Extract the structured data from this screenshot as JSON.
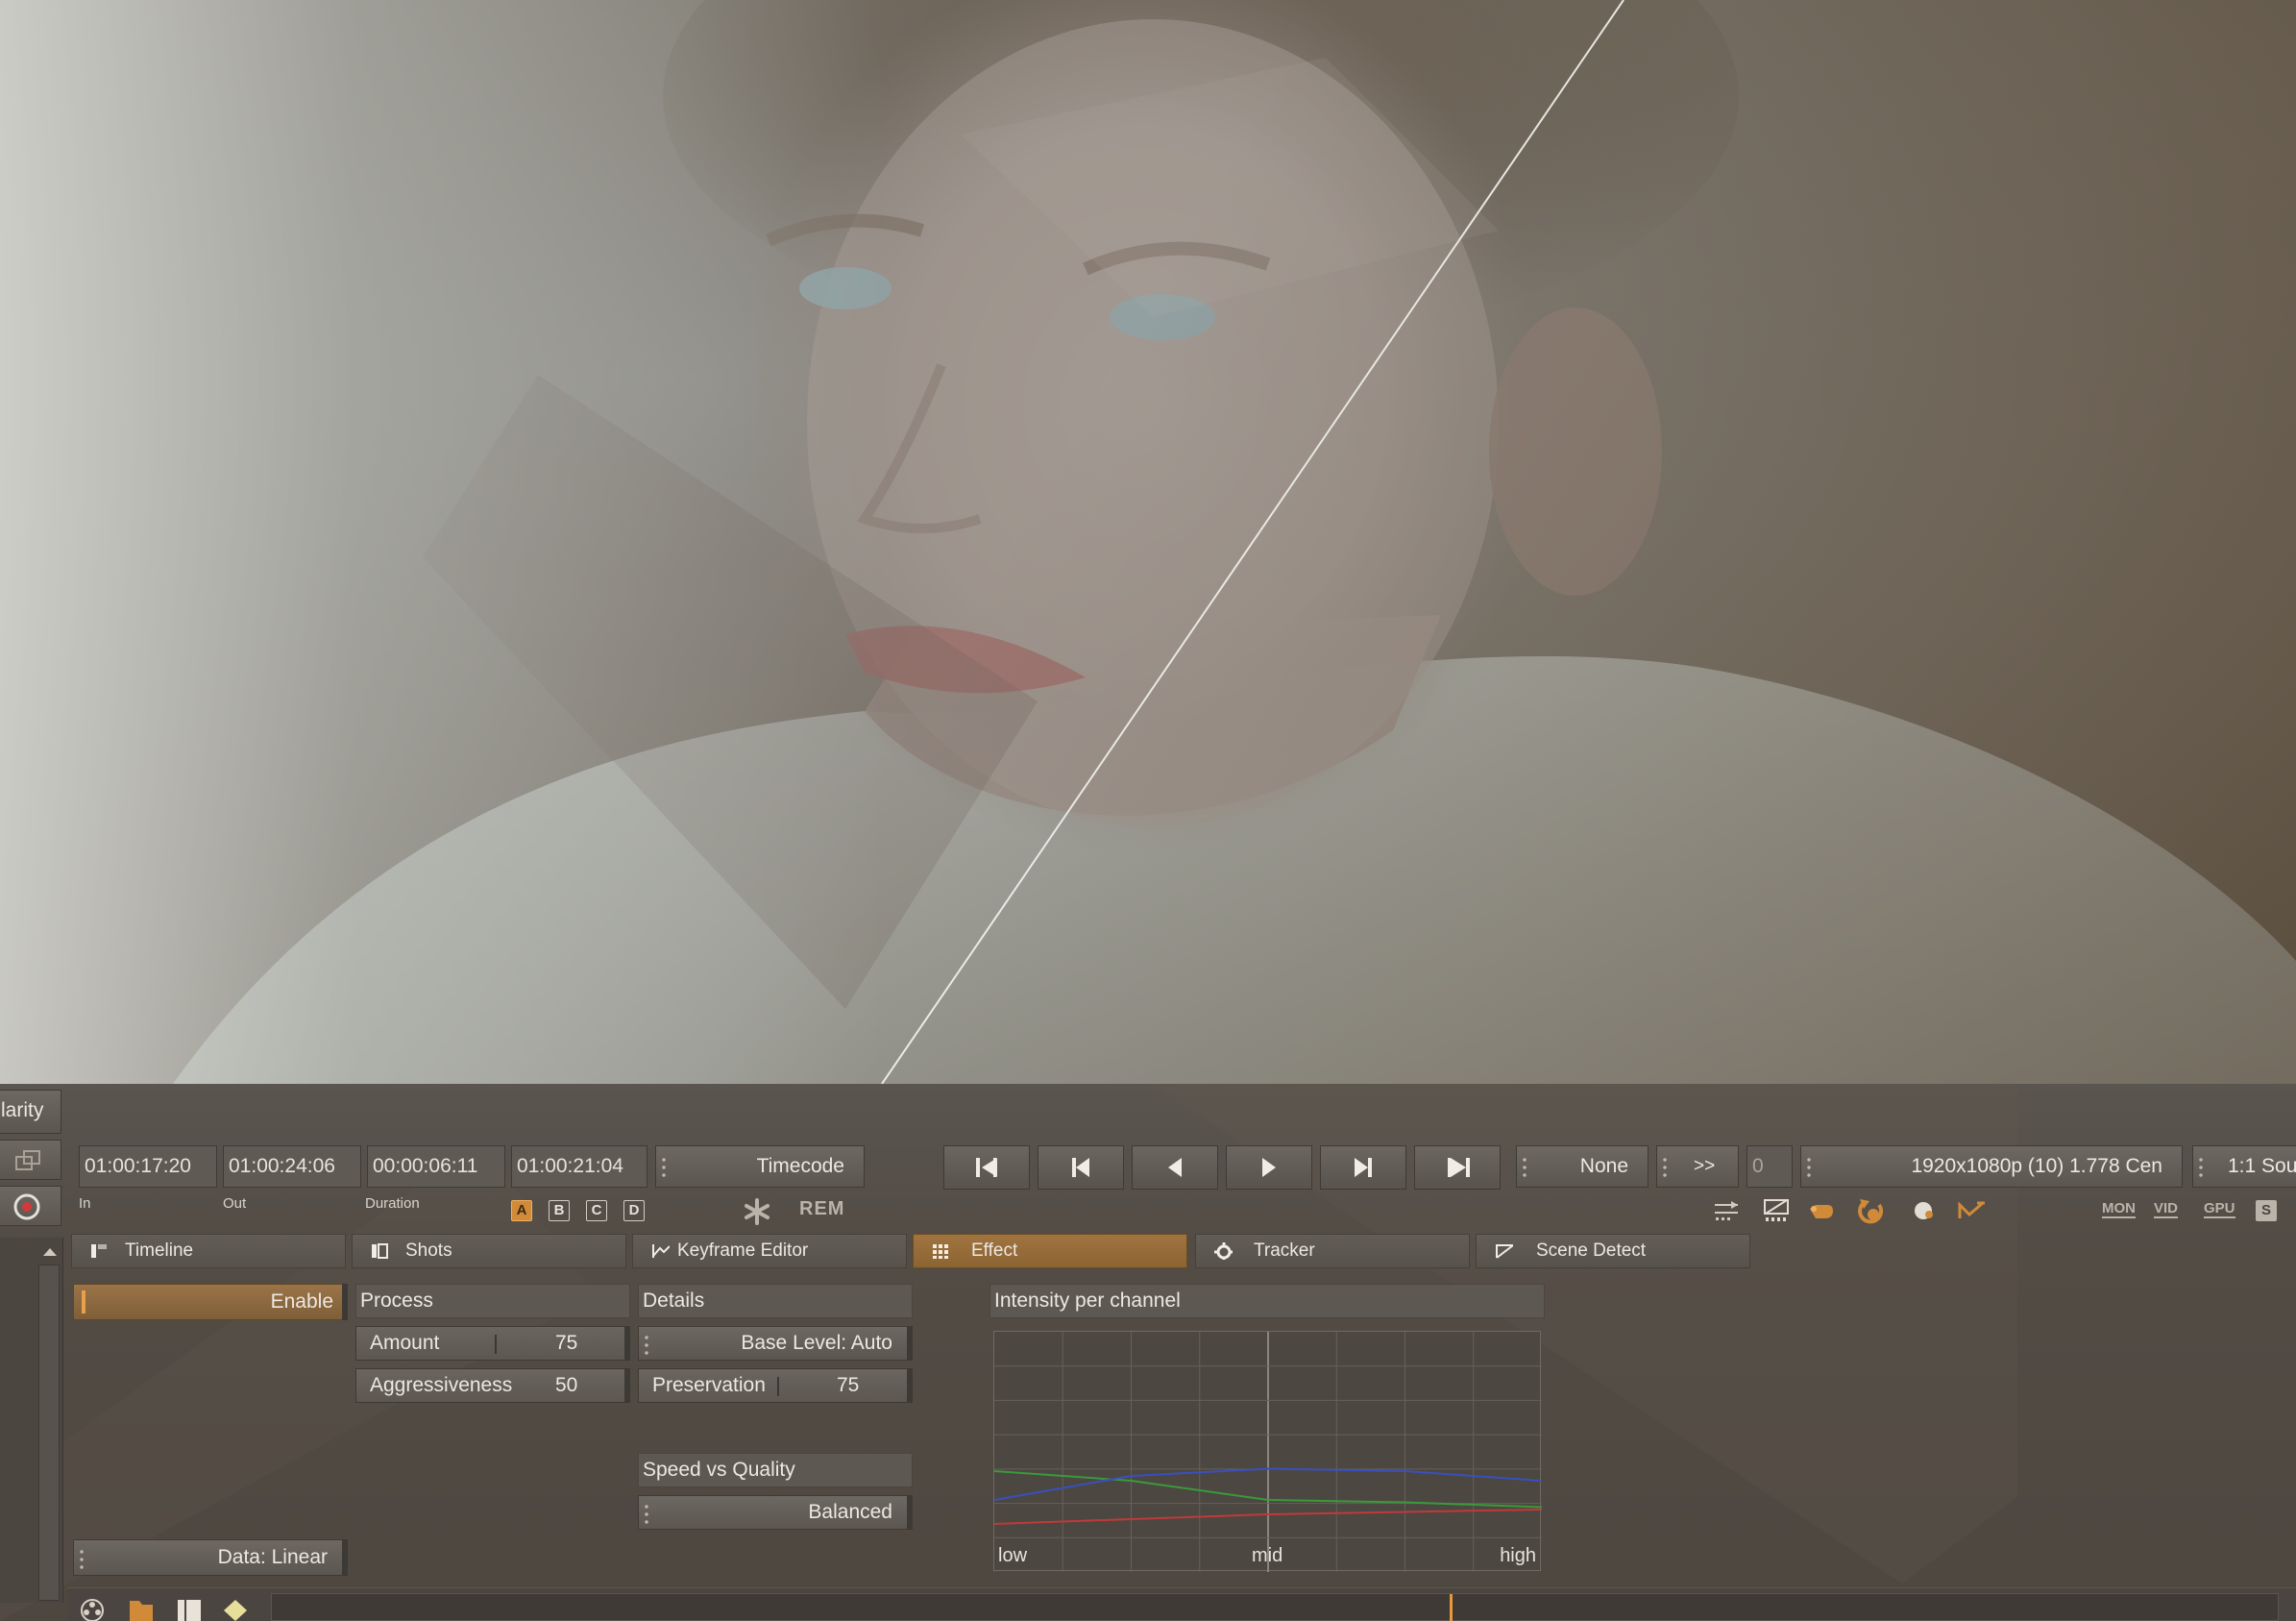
{
  "left_strip": {
    "clarity_label": "larity"
  },
  "timecodes": {
    "in_value": "01:00:17:20",
    "out_value": "01:00:24:06",
    "duration_value": "00:00:06:11",
    "current_value": "01:00:21:04",
    "in_label": "In",
    "out_label": "Out",
    "duration_label": "Duration",
    "mode_label": "Timecode"
  },
  "ab_buttons": [
    "A",
    "B",
    "C",
    "D"
  ],
  "rem_label": "REM",
  "transport": {
    "playback_mode": "None",
    "skip_label": ">>",
    "frame_value": "0",
    "format_label": "1920x1080p (10) 1.778 Cen",
    "zoom_label": "1:1 Sou"
  },
  "monitor_icons": [
    "MON",
    "VID",
    "GPU",
    "S"
  ],
  "tabs": [
    {
      "label": "Timeline",
      "active": false
    },
    {
      "label": "Shots",
      "active": false
    },
    {
      "label": "Keyframe Editor",
      "active": false
    },
    {
      "label": "Effect",
      "active": true
    },
    {
      "label": "Tracker",
      "active": false
    },
    {
      "label": "Scene Detect",
      "active": false
    }
  ],
  "effect": {
    "enable_label": "Enable",
    "data_label": "Data: Linear",
    "process_header": "Process",
    "amount_label": "Amount",
    "amount_value": "75",
    "aggressiveness_label": "Aggressiveness",
    "aggressiveness_value": "50",
    "details_header": "Details",
    "base_level_label": "Base Level: Auto",
    "preservation_label": "Preservation",
    "preservation_value": "75",
    "speed_quality_header": "Speed vs Quality",
    "speed_quality_value": "Balanced",
    "intensity_header": "Intensity per channel",
    "graph_low": "low",
    "graph_mid": "mid",
    "graph_high": "high"
  },
  "colors": {
    "accent": "#d08a38",
    "active_tab": "#9a6e3c",
    "playhead": "#e89a3a"
  },
  "chart_data": {
    "type": "line",
    "x": [
      0,
      0.25,
      0.5,
      0.75,
      1
    ],
    "x_tick_labels": [
      "low",
      "mid",
      "high"
    ],
    "series": [
      {
        "color": "#3a9a3a",
        "values": [
          0.42,
          0.38,
          0.3,
          0.29,
          0.27
        ]
      },
      {
        "color": "#3a4fc0",
        "values": [
          0.3,
          0.4,
          0.43,
          0.42,
          0.38
        ]
      },
      {
        "color": "#c03a3a",
        "values": [
          0.2,
          0.22,
          0.24,
          0.25,
          0.26
        ]
      }
    ],
    "ylim": [
      0,
      1
    ],
    "grid": true
  }
}
